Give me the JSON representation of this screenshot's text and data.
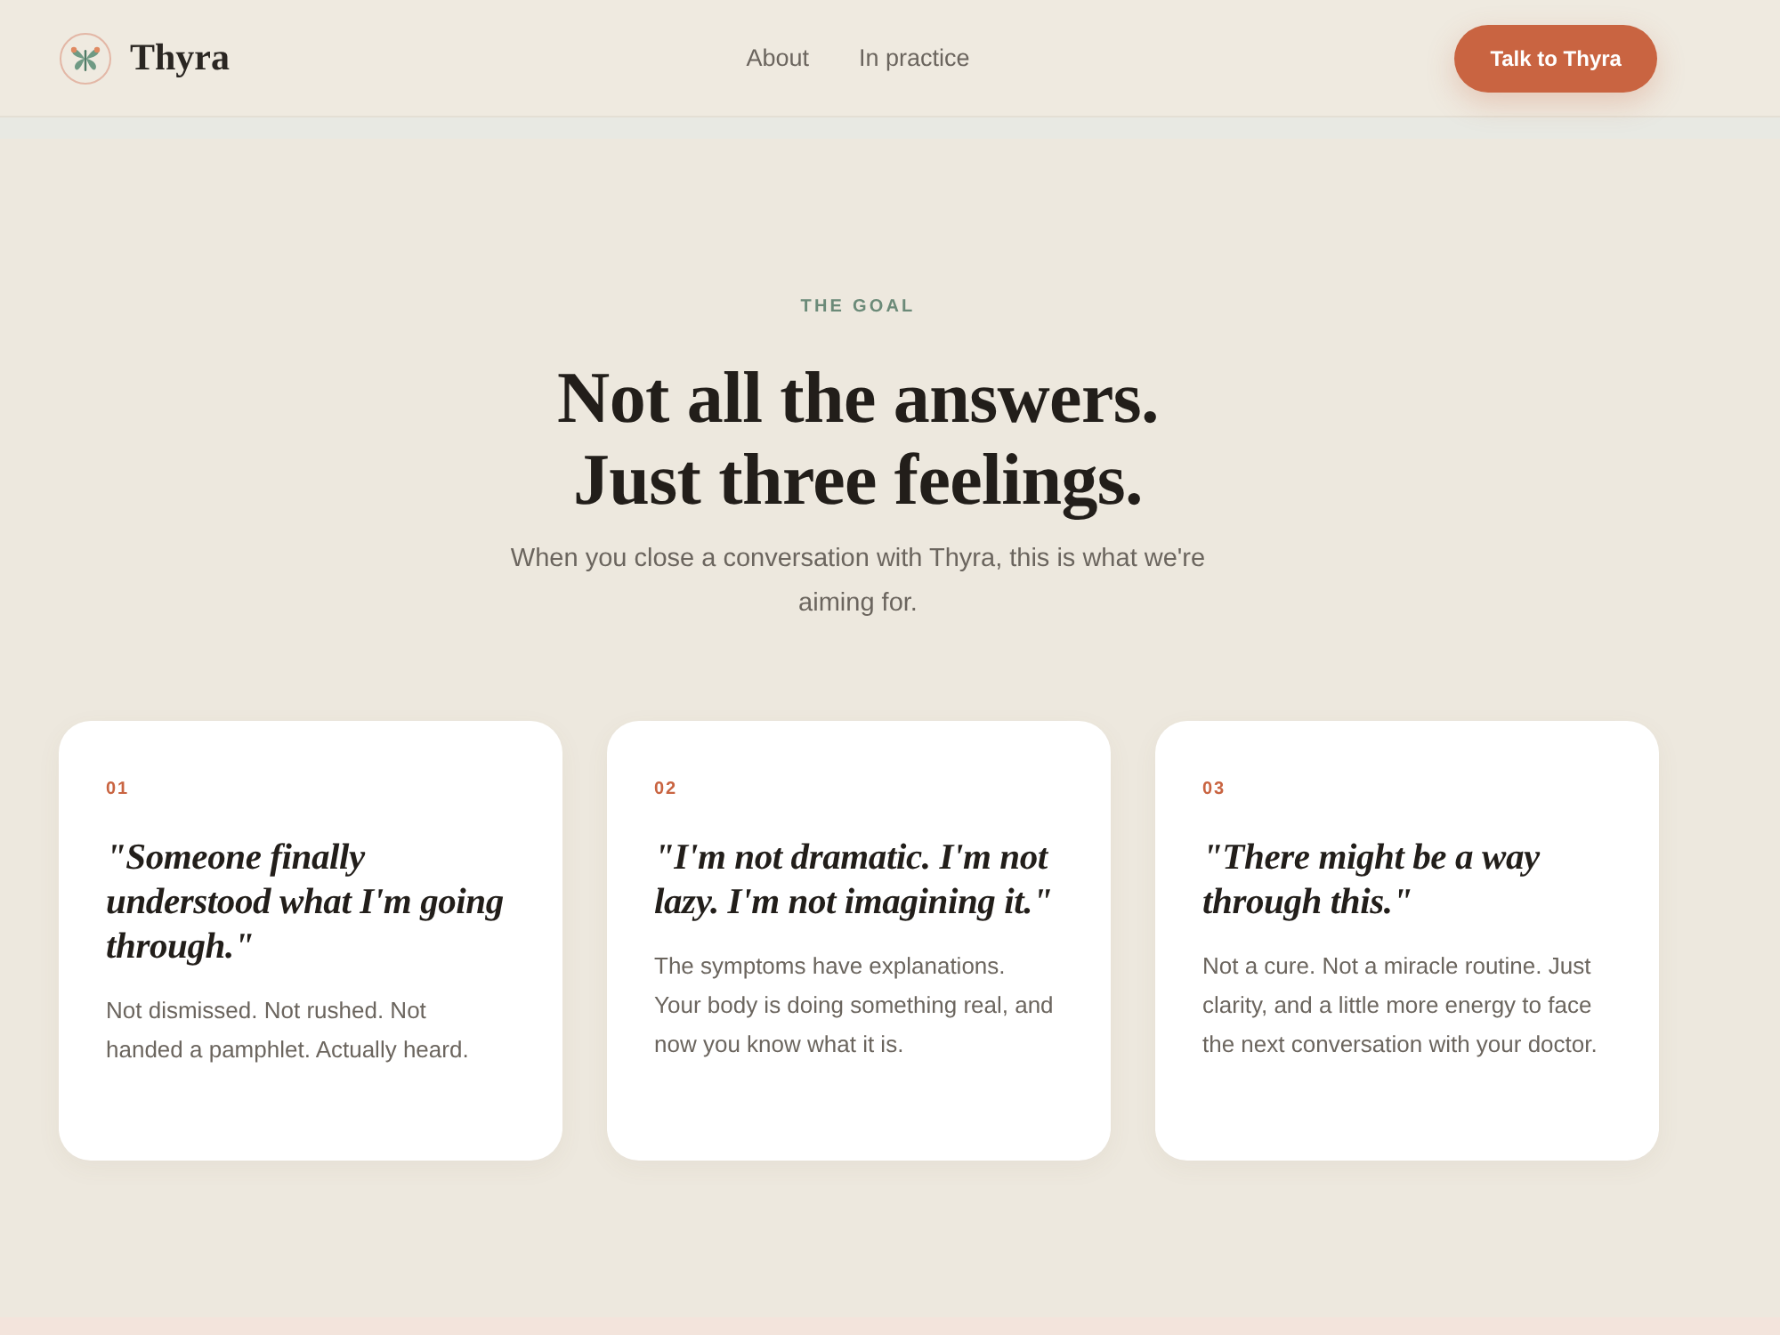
{
  "header": {
    "brand": "Thyra",
    "nav": [
      {
        "label": "About"
      },
      {
        "label": "In practice"
      }
    ],
    "cta": "Talk to Thyra"
  },
  "section": {
    "eyebrow": "THE GOAL",
    "title_lines": [
      "Not all the answers.",
      "Just three feelings."
    ],
    "subtitle": "When you close a conversation with Thyra, this is what we're aiming for.",
    "cards": [
      {
        "number": "01",
        "quote": "\"Someone finally understood what I'm going through.\"",
        "body": "Not dismissed. Not rushed. Not handed a pamphlet. Actually heard."
      },
      {
        "number": "02",
        "quote": "\"I'm not dramatic. I'm not lazy. I'm not imagining it.\"",
        "body": "The symptoms have explanations. Your body is doing something real, and now you know what it is."
      },
      {
        "number": "03",
        "quote": "\"There might be a way through this.\"",
        "body": "Not a cure. Not a miracle routine. Just clarity, and a little more energy to face the next conversation with your doctor."
      }
    ]
  }
}
